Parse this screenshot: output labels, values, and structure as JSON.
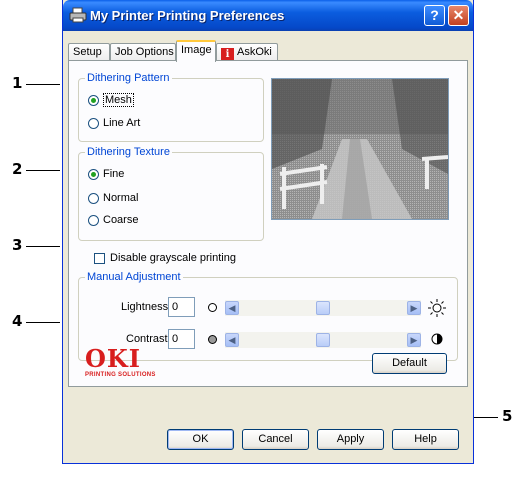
{
  "window": {
    "title": "My Printer Printing Preferences"
  },
  "titlebar_buttons": {
    "help": "?",
    "close": "✕"
  },
  "tabs": [
    {
      "label": "Setup",
      "active": false
    },
    {
      "label": "Job Options",
      "active": false
    },
    {
      "label": "Image",
      "active": true
    },
    {
      "label": "AskOki",
      "active": false,
      "icon": "info-icon"
    }
  ],
  "dithering_pattern": {
    "legend": "Dithering Pattern",
    "options": [
      {
        "label": "Mesh",
        "selected": true
      },
      {
        "label": "Line Art",
        "selected": false
      }
    ]
  },
  "dithering_texture": {
    "legend": "Dithering Texture",
    "options": [
      {
        "label": "Fine",
        "selected": true
      },
      {
        "label": "Normal",
        "selected": false
      },
      {
        "label": "Coarse",
        "selected": false
      }
    ]
  },
  "grayscale": {
    "label": "Disable grayscale printing",
    "checked": false
  },
  "manual_adjustment": {
    "legend": "Manual Adjustment",
    "lightness": {
      "label": "Lightness:",
      "value": "0"
    },
    "contrast": {
      "label": "Contrast:",
      "value": "0"
    }
  },
  "logo": {
    "text": "OKI",
    "subtext": "PRINTING SOLUTIONS"
  },
  "buttons": {
    "default": "Default",
    "ok": "OK",
    "cancel": "Cancel",
    "apply": "Apply",
    "help": "Help"
  },
  "callouts": [
    "1",
    "2",
    "3",
    "4",
    "5"
  ],
  "colors": {
    "titlebar": "#0b5ddf",
    "legend_text": "#0046d5",
    "oki_red": "#d81e1e",
    "radio_dot": "#21a121"
  }
}
